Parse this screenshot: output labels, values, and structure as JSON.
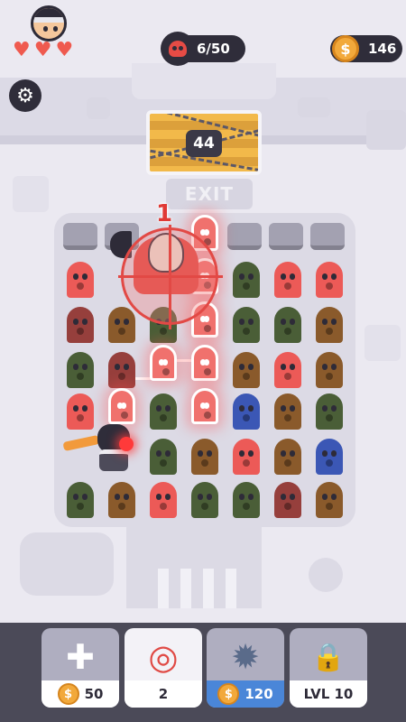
{
  "hud": {
    "lives": [
      "♥",
      "♥",
      "♥"
    ],
    "kills_text": "6/50",
    "coins_text": "146",
    "coin_symbol": "$",
    "settings_icon": "gear-icon"
  },
  "level": {
    "gate_counter": "44",
    "exit_sign": "EXIT",
    "target_count": "1"
  },
  "powerups": [
    {
      "name": "health-kit",
      "cost": "50",
      "currency": "$"
    },
    {
      "name": "target-missile",
      "count": "2"
    },
    {
      "name": "grenade",
      "cost": "120",
      "currency": "$"
    },
    {
      "name": "locked",
      "label": "LVL 10"
    }
  ],
  "colors": {
    "accent_red": "#ec5a57",
    "dark": "#2f2d3a",
    "coin": "#f2a93b",
    "blue_button": "#4a86d8"
  }
}
